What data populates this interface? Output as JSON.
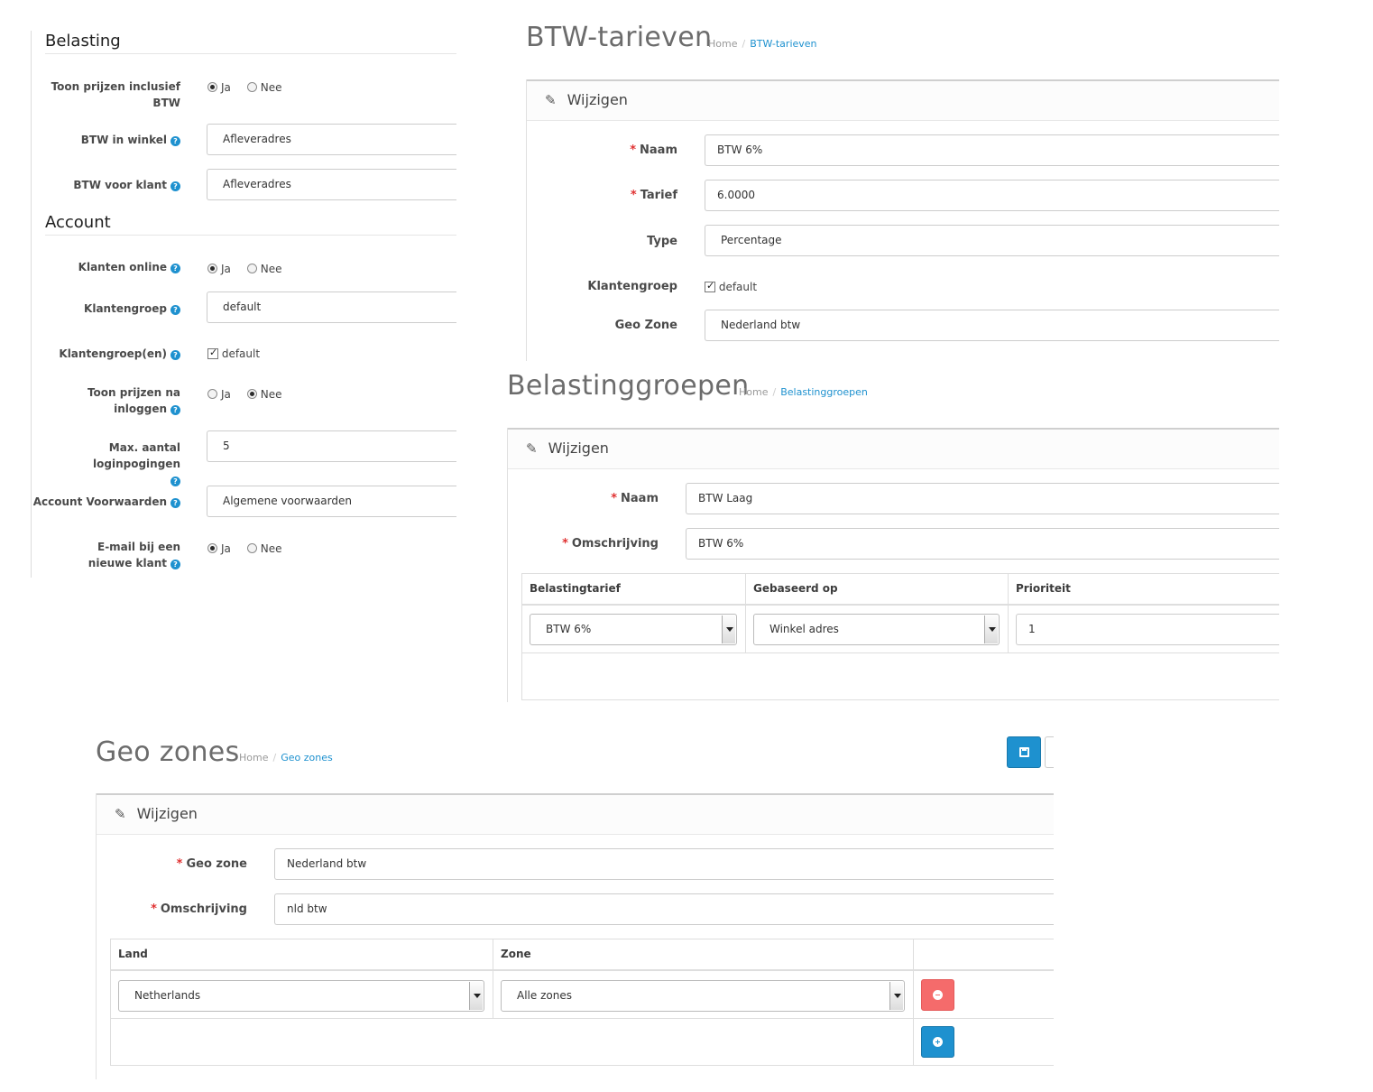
{
  "settings": {
    "belasting_title": "Belasting",
    "account_title": "Account",
    "toon_incl_label": "Toon prijzen inclusief BTW",
    "toon_incl_ja": "Ja",
    "toon_incl_nee": "Nee",
    "btw_winkel_label": "BTW in winkel",
    "btw_winkel_value": "Afleveradres",
    "btw_klant_label": "BTW voor klant",
    "btw_klant_value": "Afleveradres",
    "klanten_online_label": "Klanten online",
    "klanten_online_ja": "Ja",
    "klanten_online_nee": "Nee",
    "klantengroep_label": "Klantengroep",
    "klantengroep_value": "default",
    "klantengroepen_label": "Klantengroep(en)",
    "klantengroepen_option": "default",
    "toon_na_inloggen_label": "Toon prijzen na inloggen",
    "toon_na_ja": "Ja",
    "toon_na_nee": "Nee",
    "max_login_label": "Max. aantal loginpogingen",
    "max_login_value": "5",
    "voorwaarden_label": "Account Voorwaarden",
    "voorwaarden_value": "Algemene voorwaarden",
    "email_label": "E-mail bij een nieuwe klant",
    "email_ja": "Ja",
    "email_nee": "Nee",
    "help_glyph": "?"
  },
  "btw_tarieven": {
    "title": "BTW-tarieven",
    "crumb_home": "Home",
    "crumb_sep": "/",
    "crumb_current": "BTW-tarieven",
    "panel_title": "Wijzigen",
    "req": "*",
    "naam_label": "Naam",
    "naam_value": "BTW 6%",
    "tarief_label": "Tarief",
    "tarief_value": "6.0000",
    "type_label": "Type",
    "type_value": "Percentage",
    "klantengroep_label": "Klantengroep",
    "klantengroep_option": "default",
    "geo_label": "Geo Zone",
    "geo_value": "Nederland btw"
  },
  "belastinggroepen": {
    "title": "Belastinggroepen",
    "crumb_home": "Home",
    "crumb_sep": "/",
    "crumb_current": "Belastinggroepen",
    "panel_title": "Wijzigen",
    "req": "*",
    "naam_label": "Naam",
    "naam_value": "BTW Laag",
    "omschrijving_label": "Omschrijving",
    "omschrijving_value": "BTW 6%",
    "col_tarief": "Belastingtarief",
    "col_gebaseerd": "Gebaseerd op",
    "col_prioriteit": "Prioriteit",
    "row_tarief": "BTW 6%",
    "row_gebaseerd": "Winkel adres",
    "row_prioriteit": "1"
  },
  "geo_zones": {
    "title": "Geo zones",
    "crumb_home": "Home",
    "crumb_sep": "/",
    "crumb_current": "Geo zones",
    "panel_title": "Wijzigen",
    "req": "*",
    "geo_label": "Geo zone",
    "geo_value": "Nederland btw",
    "omschrijving_label": "Omschrijving",
    "omschrijving_value": "nld btw",
    "col_land": "Land",
    "col_zone": "Zone",
    "row_land": "Netherlands",
    "row_zone": "Alle zones",
    "save_icon": "save-icon",
    "remove_icon": "minus-circle-icon",
    "add_icon": "plus-circle-icon"
  },
  "colors": {
    "accent": "#1e91cf",
    "danger": "#f56b6b",
    "required": "#e03131"
  }
}
